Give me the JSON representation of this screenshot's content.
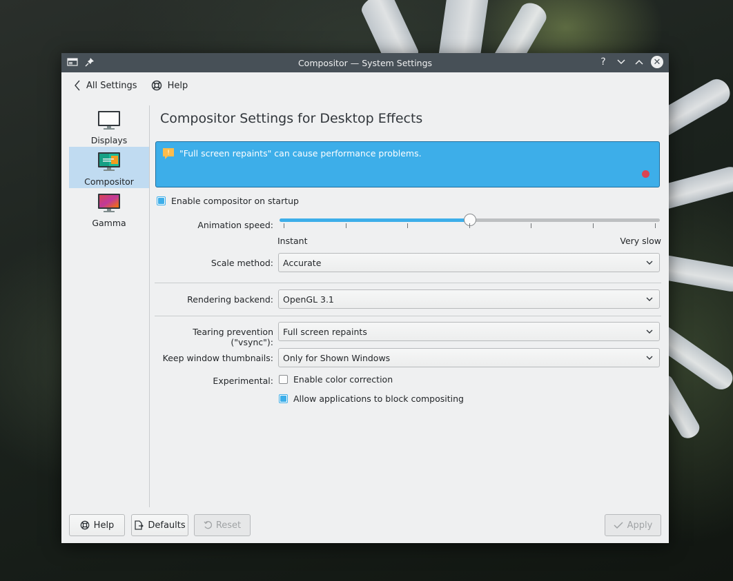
{
  "window": {
    "title": "Compositor — System Settings"
  },
  "toolbar": {
    "back_label": "All Settings",
    "help_label": "Help"
  },
  "sidebar": {
    "items": [
      {
        "label": "Displays",
        "icon": "monitor-icon"
      },
      {
        "label": "Compositor",
        "icon": "compositor-icon",
        "active": true
      },
      {
        "label": "Gamma",
        "icon": "gamma-icon"
      }
    ]
  },
  "main": {
    "title": "Compositor Settings for Desktop Effects",
    "warning": "\"Full screen repaints\" can cause performance problems.",
    "enable_startup_label": "Enable compositor on startup",
    "enable_startup_checked": true,
    "animation_speed_label": "Animation speed:",
    "animation_speed_value": 0.5,
    "animation_min_label": "Instant",
    "animation_max_label": "Very slow",
    "scale_method_label": "Scale method:",
    "scale_method_value": "Accurate",
    "rendering_backend_label": "Rendering backend:",
    "rendering_backend_value": "OpenGL 3.1",
    "tearing_label": "Tearing prevention (\"vsync\"):",
    "tearing_value": "Full screen repaints",
    "thumbnails_label": "Keep window thumbnails:",
    "thumbnails_value": "Only for Shown Windows",
    "experimental_label": "Experimental:",
    "color_correction_label": "Enable color correction",
    "color_correction_checked": false,
    "allow_block_label": "Allow applications to block compositing",
    "allow_block_checked": true
  },
  "footer": {
    "help_label": "Help",
    "defaults_label": "Defaults",
    "reset_label": "Reset",
    "apply_label": "Apply"
  },
  "colors": {
    "accent": "#3daee9",
    "titlebar": "#475057",
    "window_bg": "#eff0f1",
    "active_item": "#c0dbf1"
  }
}
